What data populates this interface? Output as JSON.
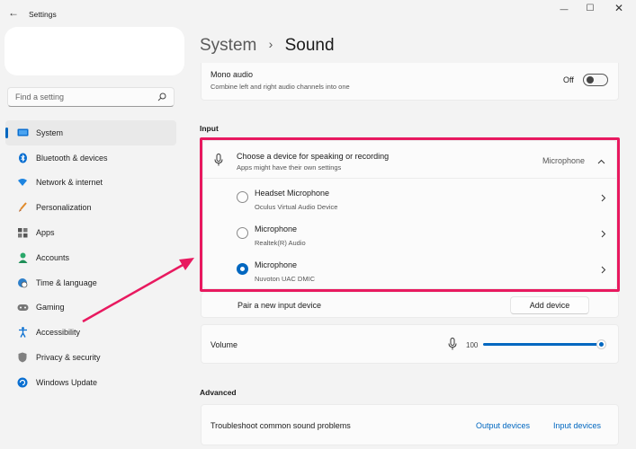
{
  "window": {
    "title": "Settings",
    "back_glyph": "←",
    "minimize_glyph": "—",
    "maximize_glyph": "☐",
    "close_glyph": "✕"
  },
  "search": {
    "placeholder": "Find a setting",
    "icon": "search-icon"
  },
  "sidebar": {
    "items": [
      {
        "label": "System",
        "icon": "monitor-icon",
        "selected": true
      },
      {
        "label": "Bluetooth & devices",
        "icon": "bluetooth-icon"
      },
      {
        "label": "Network & internet",
        "icon": "wifi-icon"
      },
      {
        "label": "Personalization",
        "icon": "brush-icon"
      },
      {
        "label": "Apps",
        "icon": "apps-icon"
      },
      {
        "label": "Accounts",
        "icon": "person-icon"
      },
      {
        "label": "Time & language",
        "icon": "globe-clock-icon"
      },
      {
        "label": "Gaming",
        "icon": "gamepad-icon"
      },
      {
        "label": "Accessibility",
        "icon": "accessibility-icon"
      },
      {
        "label": "Privacy & security",
        "icon": "shield-icon"
      },
      {
        "label": "Windows Update",
        "icon": "update-icon"
      }
    ]
  },
  "breadcrumb": {
    "parent": "System",
    "separator": "›",
    "current": "Sound"
  },
  "mono_audio": {
    "title": "Mono audio",
    "subtitle": "Combine left and right audio channels into one",
    "state_label": "Off"
  },
  "input": {
    "section_label": "Input",
    "chooser": {
      "title": "Choose a device for speaking or recording",
      "subtitle": "Apps might have their own settings",
      "selected_value": "Microphone",
      "chevron": "^"
    },
    "devices": [
      {
        "name": "Headset Microphone",
        "detail": "Oculus Virtual Audio Device",
        "checked": false
      },
      {
        "name": "Microphone",
        "detail": "Realtek(R) Audio",
        "checked": false
      },
      {
        "name": "Microphone",
        "detail": "Nuvoton UAC DMIC",
        "checked": true
      }
    ],
    "pair": {
      "label": "Pair a new input device",
      "button": "Add device"
    },
    "volume": {
      "label": "Volume",
      "value": "100"
    }
  },
  "advanced": {
    "section_label": "Advanced",
    "troubleshoot": {
      "label": "Troubleshoot common sound problems",
      "link_output": "Output devices",
      "link_input": "Input devices"
    }
  },
  "colors": {
    "accent": "#0067c0",
    "highlight": "#e8195f"
  }
}
